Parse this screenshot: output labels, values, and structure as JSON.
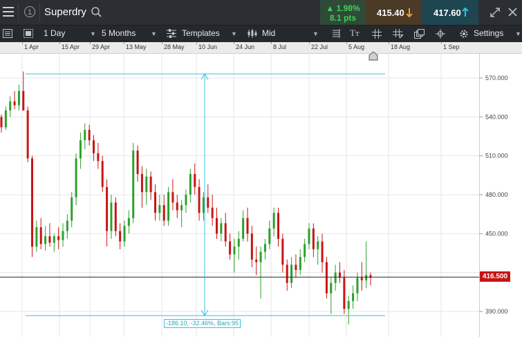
{
  "header": {
    "menu_icon": "hamburger-icon",
    "info_icon": "info-circle-icon",
    "instrument": "Superdry",
    "search_icon": "search-icon",
    "change_pct": "1.98%",
    "change_pts": "8.1 pts",
    "sell_price": "415.40",
    "buy_price": "417.60",
    "expand_icon": "expand-icon",
    "close_icon": "close-icon"
  },
  "toolbar": {
    "interval": "1 Day",
    "range": "5 Months",
    "templates": "Templates",
    "price_type": "Mid",
    "settings": "Settings"
  },
  "date_axis": [
    "1 Apr",
    "15 Apr",
    "29 Apr",
    "13 May",
    "28 May",
    "10 Jun",
    "24 Jun",
    "8 Jul",
    "22 Jul",
    "5 Aug",
    "18 Aug",
    "1 Sep"
  ],
  "price_axis": [
    "570.000",
    "540.000",
    "510.000",
    "480.000",
    "450.000",
    "390.000"
  ],
  "current_price": "416.500",
  "measure_label": "-186.10, -32.46%, Bars:95",
  "colors": {
    "up": "#2ca02c",
    "down": "#c81414",
    "measure": "#34c2dc"
  },
  "chart_data": {
    "type": "candlestick",
    "ylim": [
      375,
      587
    ],
    "candles": [
      [
        540,
        542,
        528,
        532
      ],
      [
        532,
        548,
        530,
        545
      ],
      [
        545,
        556,
        540,
        552
      ],
      [
        552,
        560,
        546,
        549
      ],
      [
        549,
        565,
        545,
        560
      ],
      [
        560,
        575,
        548,
        545
      ],
      [
        545,
        548,
        505,
        508
      ],
      [
        508,
        510,
        432,
        440
      ],
      [
        440,
        460,
        436,
        455
      ],
      [
        455,
        462,
        438,
        442
      ],
      [
        442,
        456,
        437,
        448
      ],
      [
        448,
        458,
        440,
        443
      ],
      [
        443,
        450,
        436,
        448
      ],
      [
        448,
        455,
        438,
        445
      ],
      [
        445,
        458,
        440,
        452
      ],
      [
        452,
        465,
        446,
        460
      ],
      [
        460,
        482,
        455,
        478
      ],
      [
        478,
        512,
        472,
        508
      ],
      [
        508,
        528,
        500,
        522
      ],
      [
        522,
        535,
        515,
        530
      ],
      [
        530,
        534,
        518,
        522
      ],
      [
        522,
        526,
        506,
        512
      ],
      [
        512,
        520,
        500,
        506
      ],
      [
        506,
        510,
        482,
        486
      ],
      [
        486,
        492,
        440,
        452
      ],
      [
        452,
        480,
        446,
        474
      ],
      [
        474,
        478,
        448,
        452
      ],
      [
        452,
        458,
        438,
        444
      ],
      [
        444,
        460,
        440,
        456
      ],
      [
        456,
        468,
        450,
        462
      ],
      [
        462,
        520,
        458,
        514
      ],
      [
        514,
        518,
        490,
        496
      ],
      [
        496,
        502,
        470,
        482
      ],
      [
        482,
        500,
        472,
        494
      ],
      [
        494,
        498,
        476,
        482
      ],
      [
        482,
        488,
        460,
        466
      ],
      [
        466,
        480,
        460,
        472
      ],
      [
        472,
        480,
        456,
        460
      ],
      [
        460,
        486,
        456,
        482
      ],
      [
        482,
        492,
        468,
        474
      ],
      [
        474,
        480,
        462,
        468
      ],
      [
        468,
        476,
        455,
        472
      ],
      [
        472,
        484,
        466,
        480
      ],
      [
        480,
        500,
        474,
        496
      ],
      [
        496,
        504,
        480,
        486
      ],
      [
        486,
        492,
        460,
        466
      ],
      [
        466,
        482,
        460,
        478
      ],
      [
        478,
        488,
        466,
        470
      ],
      [
        470,
        480,
        456,
        462
      ],
      [
        462,
        470,
        446,
        450
      ],
      [
        450,
        462,
        444,
        458
      ],
      [
        458,
        466,
        440,
        444
      ],
      [
        444,
        450,
        430,
        434
      ],
      [
        434,
        446,
        420,
        440
      ],
      [
        440,
        452,
        430,
        446
      ],
      [
        446,
        468,
        444,
        462
      ],
      [
        462,
        470,
        444,
        450
      ],
      [
        450,
        456,
        424,
        430
      ],
      [
        430,
        440,
        418,
        428
      ],
      [
        428,
        440,
        400,
        436
      ],
      [
        436,
        446,
        430,
        442
      ],
      [
        442,
        460,
        438,
        454
      ],
      [
        454,
        470,
        448,
        466
      ],
      [
        466,
        470,
        440,
        446
      ],
      [
        446,
        450,
        420,
        426
      ],
      [
        426,
        430,
        406,
        412
      ],
      [
        412,
        432,
        408,
        426
      ],
      [
        426,
        434,
        416,
        422
      ],
      [
        422,
        438,
        418,
        432
      ],
      [
        432,
        446,
        428,
        442
      ],
      [
        442,
        458,
        438,
        454
      ],
      [
        454,
        458,
        432,
        438
      ],
      [
        438,
        448,
        426,
        444
      ],
      [
        444,
        450,
        420,
        428
      ],
      [
        428,
        432,
        400,
        404
      ],
      [
        404,
        416,
        388,
        412
      ],
      [
        412,
        426,
        406,
        420
      ],
      [
        420,
        428,
        412,
        416
      ],
      [
        416,
        422,
        388,
        392
      ],
      [
        392,
        402,
        380,
        398
      ],
      [
        398,
        410,
        392,
        404
      ],
      [
        404,
        420,
        398,
        416
      ],
      [
        416,
        428,
        406,
        414
      ],
      [
        414,
        444,
        408,
        418
      ],
      [
        418,
        420,
        410,
        416
      ]
    ]
  }
}
